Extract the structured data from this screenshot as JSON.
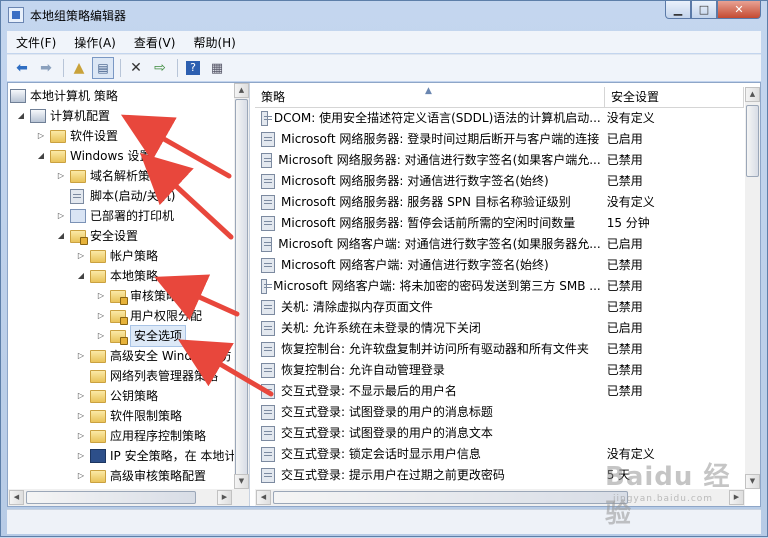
{
  "window": {
    "title": "本地组策略编辑器"
  },
  "menu": [
    "文件(F)",
    "操作(A)",
    "查看(V)",
    "帮助(H)"
  ],
  "toolbar": [
    "back-icon",
    "forward-icon",
    "up-folder-icon",
    "show-tree-icon",
    "delete-icon",
    "export-icon",
    "help-icon",
    "properties-icon"
  ],
  "tree": {
    "root": "本地计算机 策略",
    "items": [
      {
        "label": "计算机配置",
        "icon": "computer-icon"
      },
      {
        "label": "软件设置",
        "icon": "folder-icon"
      },
      {
        "label": "Windows 设置",
        "icon": "folder-icon"
      },
      {
        "label": "域名解析策",
        "icon": "folder-icon"
      },
      {
        "label": "脚本(启动/关机)",
        "icon": "script-icon"
      },
      {
        "label": "已部署的打印机",
        "icon": "printer-icon"
      },
      {
        "label": "安全设置",
        "icon": "security-icon"
      },
      {
        "label": "帐户策略",
        "icon": "folder-icon"
      },
      {
        "label": "本地策略",
        "icon": "folder-icon"
      },
      {
        "label": "审核策略",
        "icon": "folder-icon"
      },
      {
        "label": "用户权限分配",
        "icon": "folder-icon"
      },
      {
        "label": "安全选项",
        "icon": "folder-icon"
      },
      {
        "label": "高级安全 Windows 防",
        "icon": "folder-icon"
      },
      {
        "label": "网络列表管理器策略",
        "icon": "folder-icon"
      },
      {
        "label": "公钥策略",
        "icon": "folder-icon"
      },
      {
        "label": "软件限制策略",
        "icon": "folder-icon"
      },
      {
        "label": "应用程序控制策略",
        "icon": "folder-icon"
      },
      {
        "label": "IP 安全策略，在 本地计",
        "icon": "ip-security-icon"
      },
      {
        "label": "高级审核策略配置",
        "icon": "folder-icon"
      }
    ]
  },
  "list": {
    "columns": [
      "策略",
      "安全设置"
    ],
    "rows": [
      [
        "DCOM: 使用安全描述符定义语言(SDDL)语法的计算机启动...",
        "没有定义"
      ],
      [
        "Microsoft 网络服务器: 登录时间过期后断开与客户端的连接",
        "已启用"
      ],
      [
        "Microsoft 网络服务器: 对通信进行数字签名(如果客户端允...",
        "已禁用"
      ],
      [
        "Microsoft 网络服务器: 对通信进行数字签名(始终)",
        "已禁用"
      ],
      [
        "Microsoft 网络服务器: 服务器 SPN 目标名称验证级别",
        "没有定义"
      ],
      [
        "Microsoft 网络服务器: 暂停会话前所需的空闲时间数量",
        "15 分钟"
      ],
      [
        "Microsoft 网络客户端: 对通信进行数字签名(如果服务器允...",
        "已启用"
      ],
      [
        "Microsoft 网络客户端: 对通信进行数字签名(始终)",
        "已禁用"
      ],
      [
        "Microsoft 网络客户端: 将未加密的密码发送到第三方 SMB ...",
        "已禁用"
      ],
      [
        "关机: 清除虚拟内存页面文件",
        "已禁用"
      ],
      [
        "关机: 允许系统在未登录的情况下关闭",
        "已启用"
      ],
      [
        "恢复控制台: 允许软盘复制并访问所有驱动器和所有文件夹",
        "已禁用"
      ],
      [
        "恢复控制台: 允许自动管理登录",
        "已禁用"
      ],
      [
        "交互式登录: 不显示最后的用户名",
        "已禁用"
      ],
      [
        "交互式登录: 试图登录的用户的消息标题",
        ""
      ],
      [
        "交互式登录: 试图登录的用户的消息文本",
        ""
      ],
      [
        "交互式登录: 锁定会话时显示用户信息",
        "没有定义"
      ],
      [
        "交互式登录: 提示用户在过期之前更改密码",
        "5 天"
      ]
    ]
  },
  "watermark": {
    "text": "Baidu 经验",
    "sub": "jingyan.baidu.com"
  },
  "annotation_color": "#e8473c"
}
